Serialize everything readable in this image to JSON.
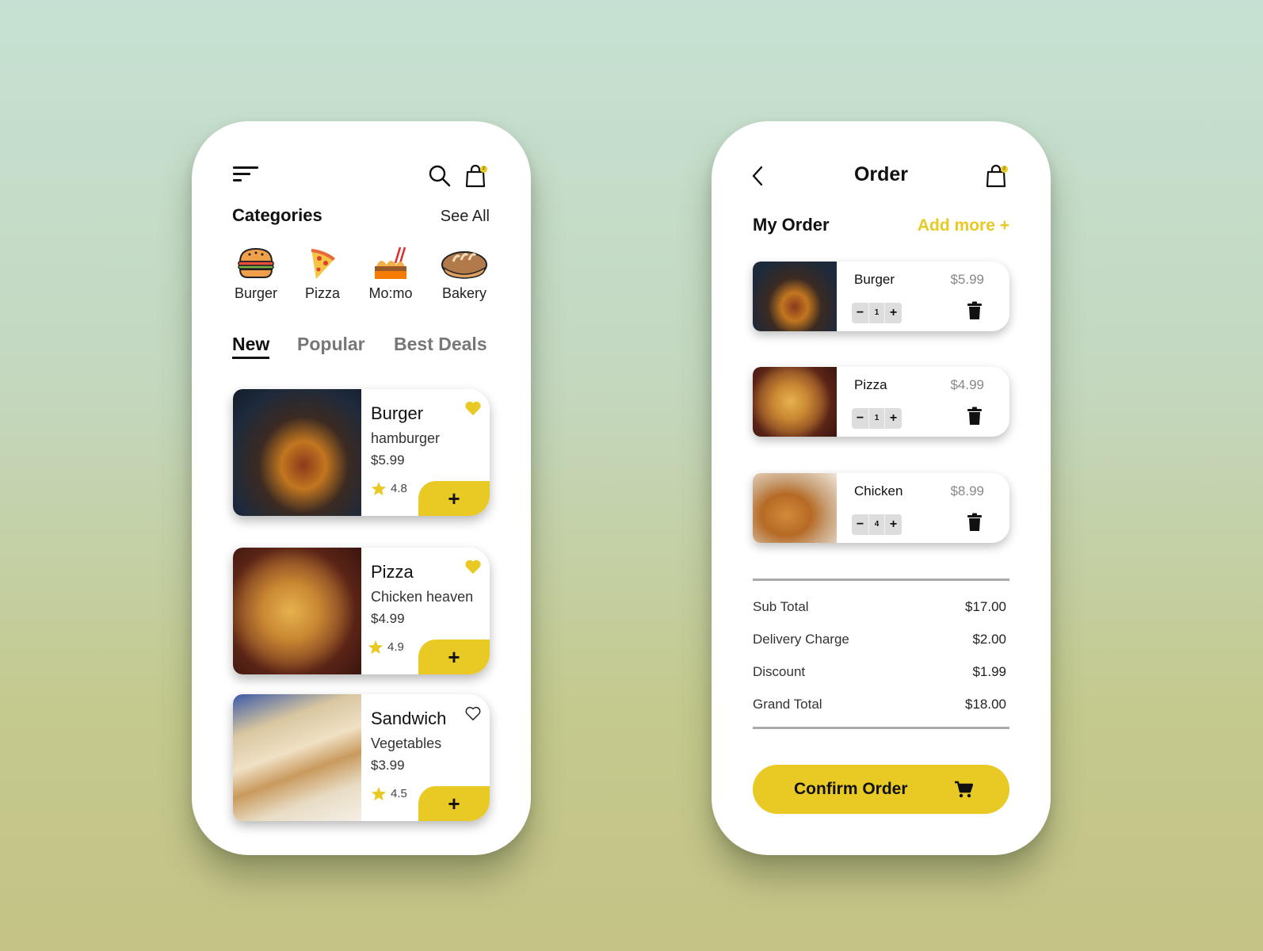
{
  "theme": {
    "accent": "#e9c923",
    "text": "#111111",
    "muted": "#777777"
  },
  "menu_screen": {
    "header": {
      "menu_icon": "hamburger-menu-icon",
      "search_icon": "search-icon",
      "bag_icon": "shopping-bag-icon",
      "bag_badge": "2"
    },
    "categories": {
      "title": "Categories",
      "see_all": "See All",
      "items": [
        {
          "label": "Burger",
          "icon": "burger-icon"
        },
        {
          "label": "Pizza",
          "icon": "pizza-slice-icon"
        },
        {
          "label": "Mo:mo",
          "icon": "momo-icon"
        },
        {
          "label": "Bakery",
          "icon": "bread-icon"
        }
      ]
    },
    "tabs": [
      {
        "label": "New",
        "active": true
      },
      {
        "label": "Popular",
        "active": false
      },
      {
        "label": "Best Deals",
        "active": false
      }
    ],
    "foods": [
      {
        "name": "Burger",
        "subtitle": "hamburger",
        "price": "$5.99",
        "rating": "4.8",
        "favorite": true,
        "add_label": "+"
      },
      {
        "name": "Pizza",
        "subtitle": "Chicken heaven",
        "price": "$4.99",
        "rating": "4.9",
        "favorite": true,
        "add_label": "+"
      },
      {
        "name": "Sandwich",
        "subtitle": "Vegetables",
        "price": "$3.99",
        "rating": "4.5",
        "favorite": false,
        "add_label": "+"
      }
    ]
  },
  "order_screen": {
    "header": {
      "back_icon": "chevron-left-icon",
      "title": "Order",
      "bag_icon": "shopping-bag-icon",
      "bag_badge": "2"
    },
    "my_order_title": "My Order",
    "add_more": "Add more +",
    "items": [
      {
        "name": "Burger",
        "price": "$5.99",
        "qty": "1",
        "minus": "−",
        "plus": "+"
      },
      {
        "name": "Pizza",
        "price": "$4.99",
        "qty": "1",
        "minus": "−",
        "plus": "+"
      },
      {
        "name": "Chicken",
        "price": "$8.99",
        "qty": "4",
        "minus": "−",
        "plus": "+"
      }
    ],
    "summary": [
      {
        "label": "Sub Total",
        "value": "$17.00"
      },
      {
        "label": "Delivery Charge",
        "value": "$2.00"
      },
      {
        "label": "Discount",
        "value": "$1.99"
      },
      {
        "label": "Grand Total",
        "value": "$18.00"
      }
    ],
    "confirm_label": "Confirm Order",
    "confirm_icon": "cart-icon"
  }
}
